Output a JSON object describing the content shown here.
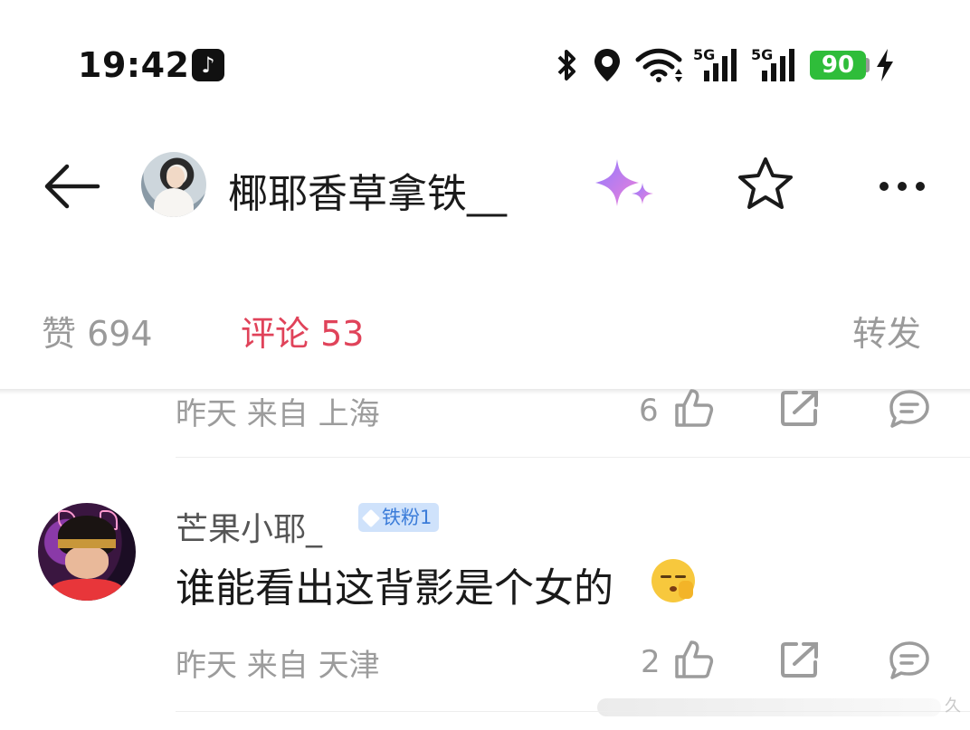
{
  "status_bar": {
    "time": "19:42",
    "app_icon": "tiktok-icon",
    "network_1": "5G",
    "network_2": "5G",
    "battery": "90",
    "icons": [
      "bluetooth-icon",
      "location-icon",
      "wifi-icon",
      "signal-icon",
      "signal-icon",
      "battery-icon",
      "charging-icon"
    ]
  },
  "header": {
    "author_name": "椰耶香草拿铁__",
    "icons": [
      "back-arrow-icon",
      "sparkle-icon",
      "star-icon",
      "more-icon"
    ]
  },
  "tabs": {
    "likes": "赞 694",
    "comments": "评论 53",
    "repost": "转发",
    "active": "comments",
    "active_color": "#e0435a"
  },
  "comments": [
    {
      "meta": "昨天  来自 上海",
      "likes": "6"
    },
    {
      "username": "芒果小耶_",
      "badge": "铁粉1",
      "text": "谁能看出这背影是个女的",
      "emoji": "thinking-face-emoji",
      "meta": "昨天  来自 天津",
      "likes": "2"
    }
  ],
  "watermark": "久"
}
